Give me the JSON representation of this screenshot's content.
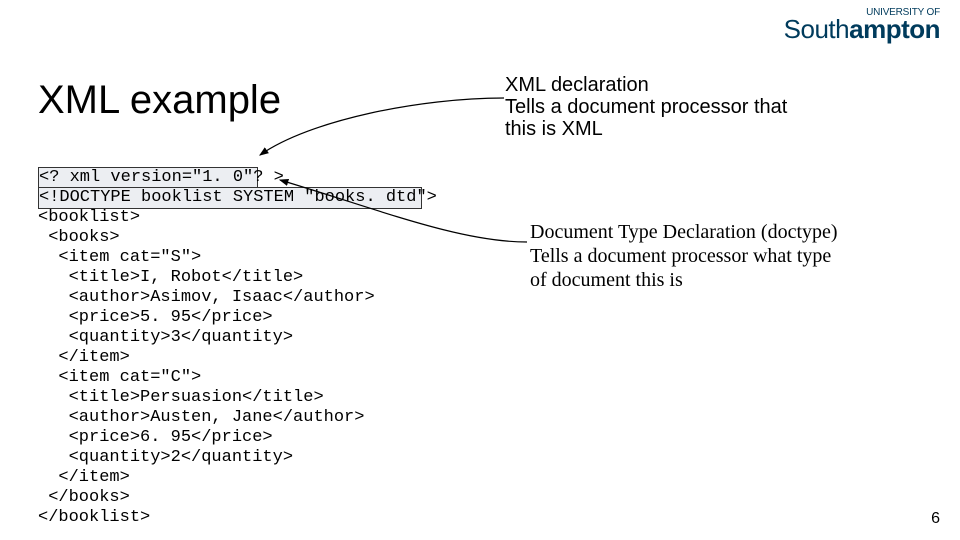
{
  "logo": {
    "top": "UNIVERSITY OF",
    "bottom_prefix": "South",
    "bottom_bold": "ampton"
  },
  "title": "XML example",
  "code": {
    "l1": "<? xml version=\"1. 0\"? >",
    "l2": "<!DOCTYPE booklist SYSTEM \"books. dtd\">",
    "l3": "<booklist>",
    "l4": " <books>",
    "l5": "  <item cat=\"S\">",
    "l6": "   <title>I, Robot</title>",
    "l7": "   <author>Asimov, Isaac</author>",
    "l8": "   <price>5. 95</price>",
    "l9": "   <quantity>3</quantity>",
    "l10": "  </item>",
    "l11": "  <item cat=\"C\">",
    "l12": "   <title>Persuasion</title>",
    "l13": "   <author>Austen, Jane</author>",
    "l14": "   <price>6. 95</price>",
    "l15": "   <quantity>2</quantity>",
    "l16": "  </item>",
    "l17": " </books>",
    "l18": "</booklist>"
  },
  "annotation1": {
    "line1": "XML declaration",
    "line2": "Tells a document processor that",
    "line3": "this is XML"
  },
  "annotation2": {
    "line1": "Document Type Declaration (doctype)",
    "line2": "Tells a document processor what type",
    "line3": "of document this is"
  },
  "page_number": "6"
}
